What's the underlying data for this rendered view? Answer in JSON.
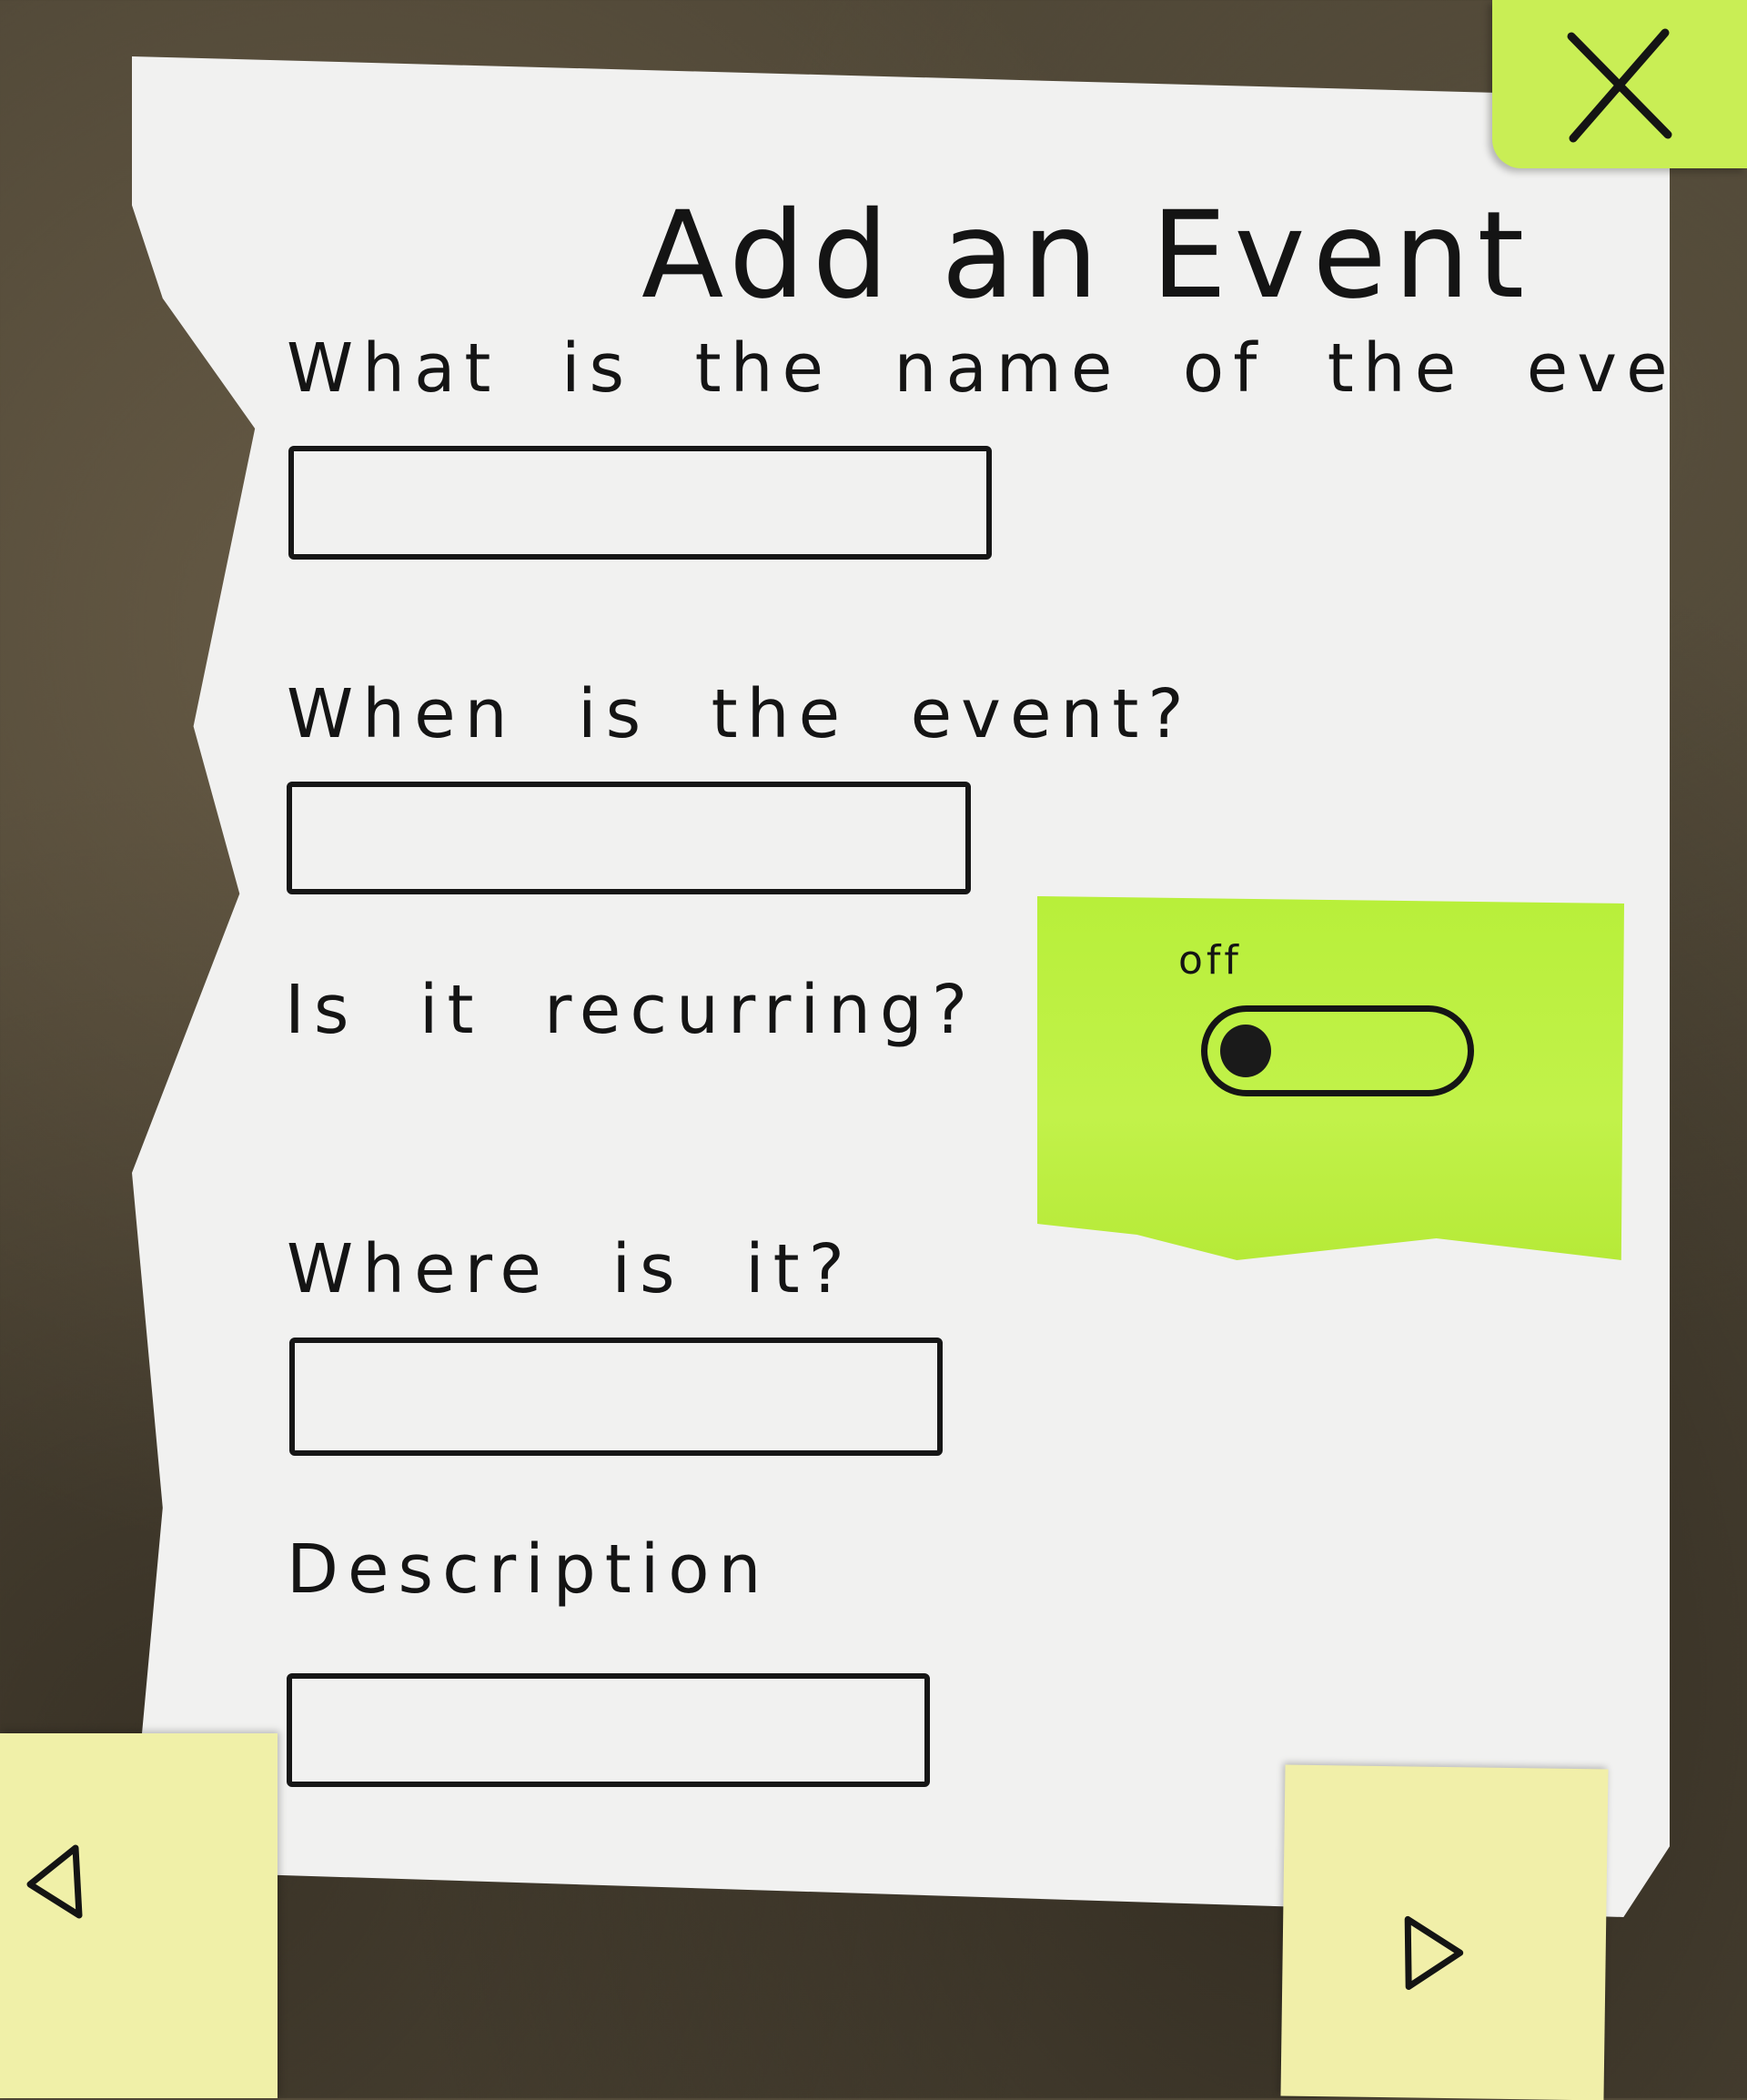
{
  "form": {
    "title": "Add an Event",
    "fields": [
      {
        "label": "What is the name of the event?",
        "value": ""
      },
      {
        "label": "When is the event?",
        "value": ""
      },
      {
        "label": "Where is it?",
        "value": ""
      },
      {
        "label": "Description",
        "value": ""
      }
    ],
    "recurring": {
      "label": "Is it recurring?",
      "toggle_state": "off"
    }
  },
  "icons": {
    "close": "close-icon",
    "previous": "left-triangle-arrow-icon",
    "next": "right-triangle-arrow-icon"
  },
  "colors": {
    "paper": "#f1f1f0",
    "ink": "#141414",
    "green_note": "#c2f24a",
    "yellow_note": "#f0f0a8",
    "background": "#4e4636"
  }
}
